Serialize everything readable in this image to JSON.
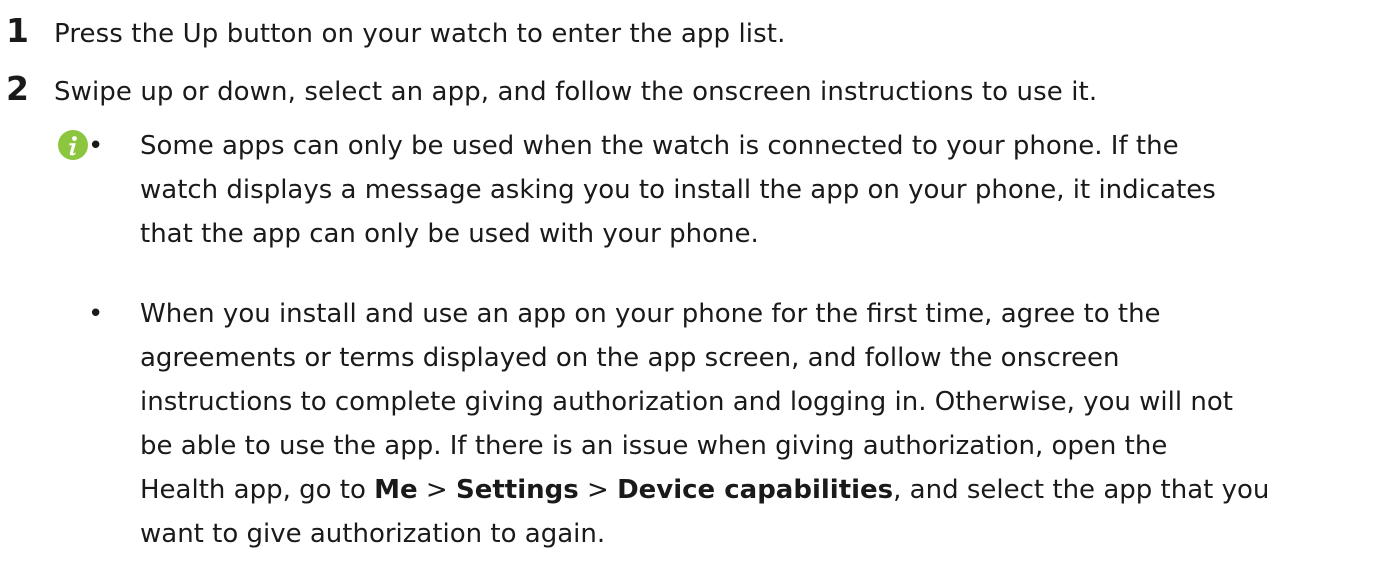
{
  "steps": [
    {
      "number": "1",
      "text": "Press the Up button on your watch to enter the app list."
    },
    {
      "number": "2",
      "text": "Swipe up or down, select an app, and follow the onscreen instructions to use it."
    }
  ],
  "note": {
    "icon": "info-icon",
    "icon_color": "#8cc63f",
    "bullet_symbol": "•",
    "bullet1_lines": [
      "Some apps can only be used when the watch is connected to your phone. If the",
      "watch displays a message asking you to install the app on your phone, it indicates",
      "that the app can only be used with your phone."
    ],
    "bullet2_lines": [
      "When you install and use an app on your phone for the first time, agree to the",
      "agreements or terms displayed on the app screen, and follow the onscreen",
      "instructions to complete giving authorization and logging in. Otherwise, you will not",
      "be able to use the app. If there is an issue when giving authorization, open the"
    ],
    "bullet2_line5": {
      "prefix": "Health app, go to ",
      "me": "Me",
      "sep1": " > ",
      "settings": "Settings",
      "sep2": " > ",
      "device_capabilities": "Device capabilities",
      "suffix": ", and select the app that you"
    },
    "bullet2_line6": "want to give authorization to again."
  }
}
